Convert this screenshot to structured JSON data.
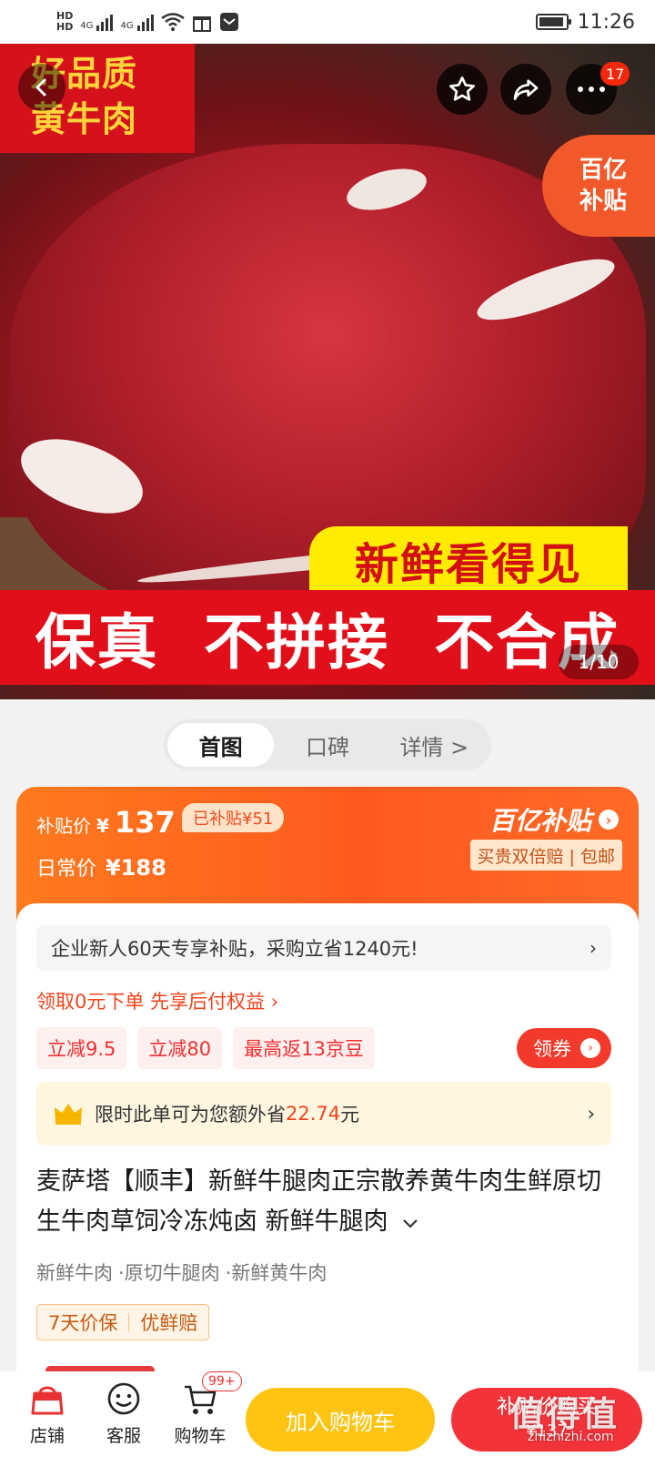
{
  "status_bar": {
    "time": "11:26",
    "net1": "4G",
    "net2": "4G"
  },
  "hero": {
    "tag_line1": "好品质",
    "tag_line2": "黄牛肉",
    "subsidy_line1": "百亿",
    "subsidy_line2": "补贴",
    "fresh": "新鲜看得见",
    "bottom_1": "保真",
    "bottom_2": "不拼接",
    "bottom_3": "不合成",
    "notification_count": "17",
    "pager": "1/10"
  },
  "tabs": [
    {
      "label": "首图"
    },
    {
      "label": "口碑"
    },
    {
      "label": "详情 >"
    }
  ],
  "price_card": {
    "subsidy_label": "补贴价",
    "currency": "¥",
    "subsidy_price": "137",
    "subsidized_badge": "已补贴¥51",
    "regular_label": "日常价",
    "regular_price": "¥188",
    "logo": "百亿补贴",
    "guarantee": "买贵双倍赔 | 包邮"
  },
  "content": {
    "promo": "企业新人60天专享补贴，采购立省1240元!",
    "pay_later": "领取0元下单 先享后付权益 ›",
    "coupons": [
      "立减9.5",
      "立减80",
      "最高返13京豆"
    ],
    "get_coupon": "领券",
    "save_prefix": "限时此单可为您额外省",
    "save_amount": "22.74",
    "save_suffix": "元",
    "title": "麦萨塔【顺丰】新鲜牛腿肉正宗散养黄牛肉生鲜原切生牛肉草饲冷冻炖卤 新鲜牛腿肉",
    "tags": [
      "新鲜牛肉",
      "·原切牛腿肉",
      "·新鲜黄牛肉"
    ],
    "services": [
      "7天价保",
      "优鲜赔"
    ]
  },
  "bottom_bar": {
    "store": "店铺",
    "service": "客服",
    "cart": "购物车",
    "cart_badge": "99+",
    "add_cart": "加入购物车",
    "buy_label": "补贴价购买",
    "buy_price": "¥137"
  },
  "watermark": {
    "main": "值得值",
    "sub": "zhizhizhi.com"
  }
}
